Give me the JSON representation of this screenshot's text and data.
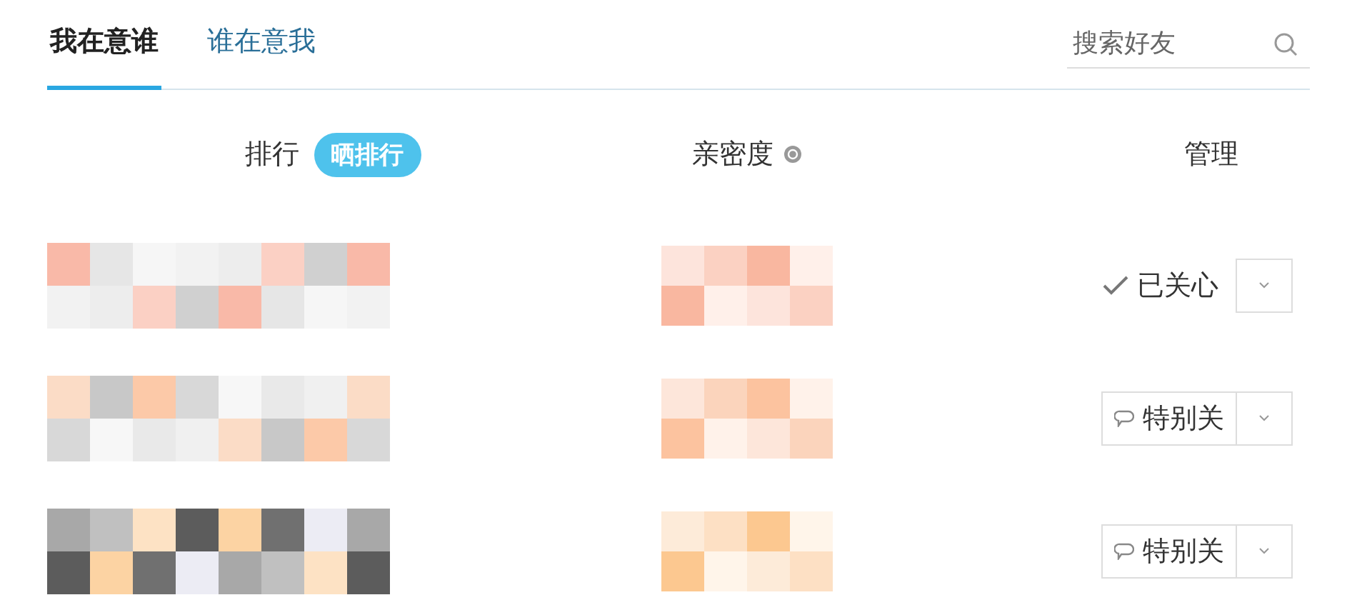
{
  "tabs": [
    {
      "label": "我在意谁",
      "selected": true
    },
    {
      "label": "谁在意我",
      "selected": false
    }
  ],
  "search": {
    "placeholder": "搜索好友"
  },
  "header": {
    "rank": "排行",
    "share_rank": "晒排行",
    "intimacy": "亲密度",
    "manage": "管理"
  },
  "rows": [
    {
      "kind": "followed",
      "label": "已关心"
    },
    {
      "kind": "special",
      "label": "特别关"
    },
    {
      "kind": "special",
      "label": "特别关"
    }
  ]
}
